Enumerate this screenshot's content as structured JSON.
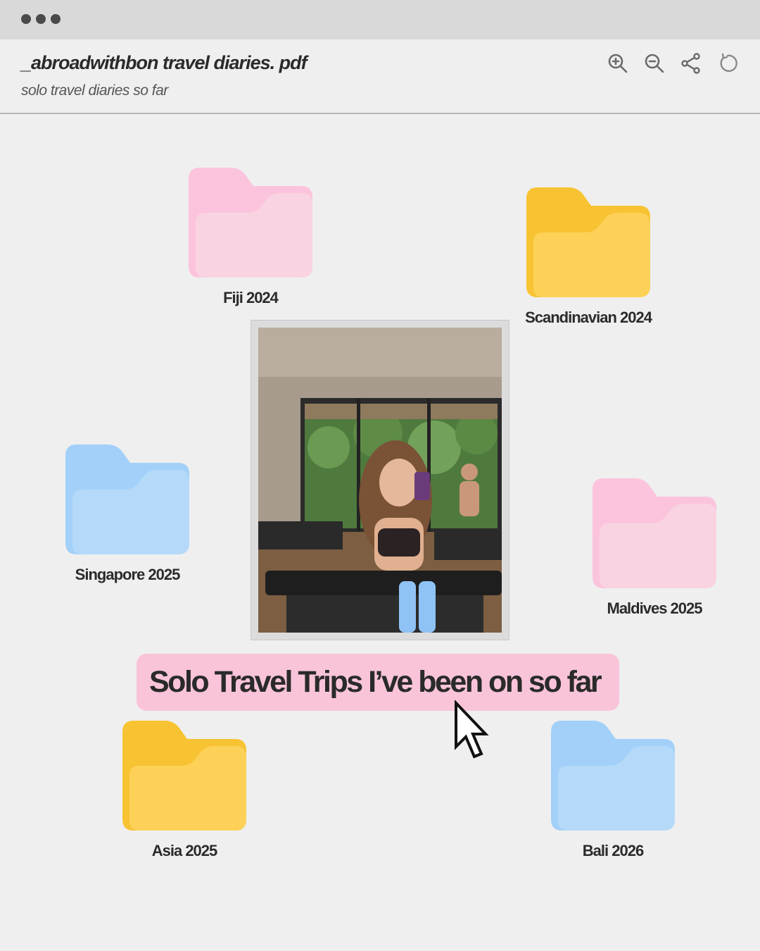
{
  "window": {
    "title": "_abroadwithbon travel diaries. pdf",
    "subtitle": "solo travel diaries so far"
  },
  "toolbar": {
    "icons": [
      "zoom-in-icon",
      "zoom-out-icon",
      "share-icon",
      "refresh-icon"
    ]
  },
  "folders": [
    {
      "label": "Fiji 2024",
      "color": "pink"
    },
    {
      "label": "Scandinavian 2024",
      "color": "yellow"
    },
    {
      "label": "Singapore 2025",
      "color": "blue"
    },
    {
      "label": "Maldives 2025",
      "color": "pink"
    },
    {
      "label": "Asia 2025",
      "color": "yellow"
    },
    {
      "label": "Bali 2026",
      "color": "blue"
    }
  ],
  "colors": {
    "pink_back": "#fcc4dc",
    "pink_front": "#f9d3e2",
    "yellow_back": "#f8c333",
    "yellow_front": "#fdd158",
    "blue_back": "#a2d0f9",
    "blue_front": "#b5daf9",
    "banner": "#f9c4d9"
  },
  "banner": {
    "text": "Solo Travel Trips I’ve been on so far"
  }
}
